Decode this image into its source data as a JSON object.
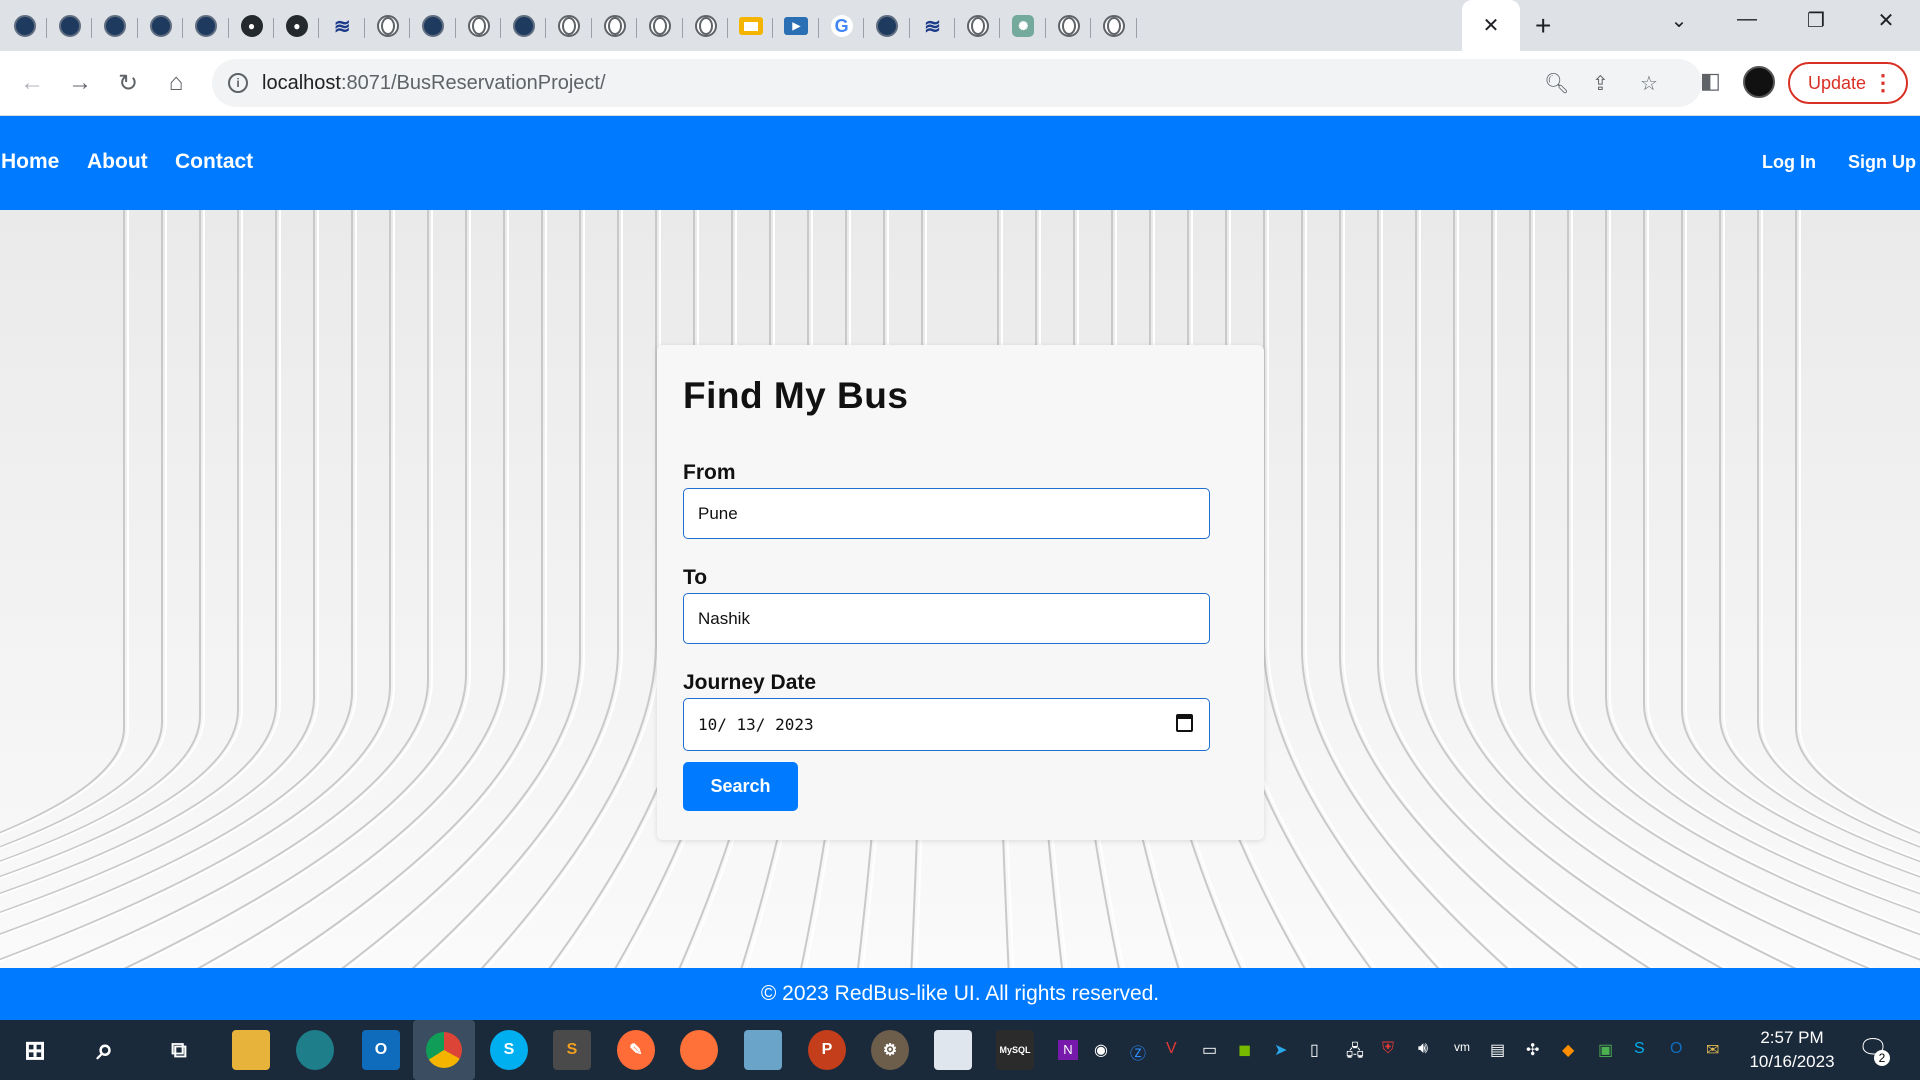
{
  "browser": {
    "tabs": [
      {
        "icon": "globe-dark-icon"
      },
      {
        "icon": "globe-dark-icon"
      },
      {
        "icon": "globe-dark-icon"
      },
      {
        "icon": "globe-dark-icon"
      },
      {
        "icon": "globe-dark-icon"
      },
      {
        "icon": "github-icon"
      },
      {
        "icon": "github-icon"
      },
      {
        "icon": "wave-icon"
      },
      {
        "icon": "globe-icon"
      },
      {
        "icon": "globe-dark-icon"
      },
      {
        "icon": "globe-icon"
      },
      {
        "icon": "globe-dark-icon"
      },
      {
        "icon": "globe-icon"
      },
      {
        "icon": "globe-icon"
      },
      {
        "icon": "globe-icon"
      },
      {
        "icon": "globe-icon"
      },
      {
        "icon": "slides-icon"
      },
      {
        "icon": "video-icon"
      },
      {
        "icon": "google-icon"
      },
      {
        "icon": "globe-dark-icon"
      },
      {
        "icon": "wave-icon"
      },
      {
        "icon": "globe-icon"
      },
      {
        "icon": "chatgpt-icon"
      },
      {
        "icon": "globe-icon"
      },
      {
        "icon": "globe-icon"
      }
    ],
    "active_tab_close": "✕",
    "new_tab": "+",
    "window_controls": {
      "chevron": "⌄",
      "minimize": "—",
      "restore": "❐",
      "close": "✕"
    },
    "address": {
      "host": "localhost",
      "rest": ":8071/BusReservationProject/"
    },
    "update_label": "Update"
  },
  "page": {
    "nav": {
      "home": "Home",
      "about": "About",
      "contact": "Contact",
      "login": "Log In",
      "signup": "Sign Up"
    },
    "form": {
      "title": "Find My Bus",
      "from_label": "From",
      "from_value": "Pune",
      "to_label": "To",
      "to_value": "Nashik",
      "date_label": "Journey Date",
      "date_value": "10/ 13/ 2023",
      "search_label": "Search"
    },
    "footer": "© 2023 RedBus-like UI. All rights reserved."
  },
  "taskbar": {
    "time": "2:57 PM",
    "date": "10/16/2023",
    "notifications": "2"
  },
  "colors": {
    "brand": "#007bff",
    "update": "#d93025",
    "taskbar": "#1b2a3a"
  }
}
